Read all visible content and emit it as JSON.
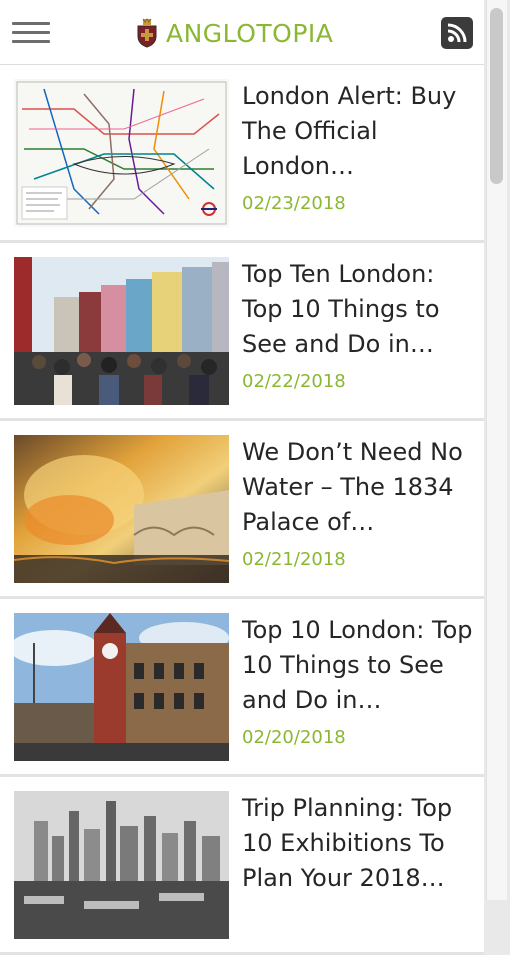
{
  "header": {
    "title": "ANGLOTOPIA",
    "menu_icon": "hamburger-menu-icon",
    "logo_icon": "crest-logo-icon",
    "rss_icon": "rss-feed-icon",
    "brand_color": "#8ab833"
  },
  "articles": [
    {
      "title": "London Alert: Buy The Official London…",
      "date": "02/23/2018",
      "image": "london-tube-map"
    },
    {
      "title": "Top Ten London: Top 10 Things to See and Do in…",
      "date": "02/22/2018",
      "image": "crowded-colorful-street"
    },
    {
      "title": "We Don’t Need No Water – The 1834 Palace of…",
      "date": "02/21/2018",
      "image": "palace-fire-painting"
    },
    {
      "title": "Top 10 London: Top 10 Things to See and Do in…",
      "date": "02/20/2018",
      "image": "red-brick-clock-tower"
    },
    {
      "title": "Trip Planning: Top 10 Exhibitions To Plan Your 2018…",
      "date": "",
      "image": "black-white-city-skyline"
    }
  ]
}
